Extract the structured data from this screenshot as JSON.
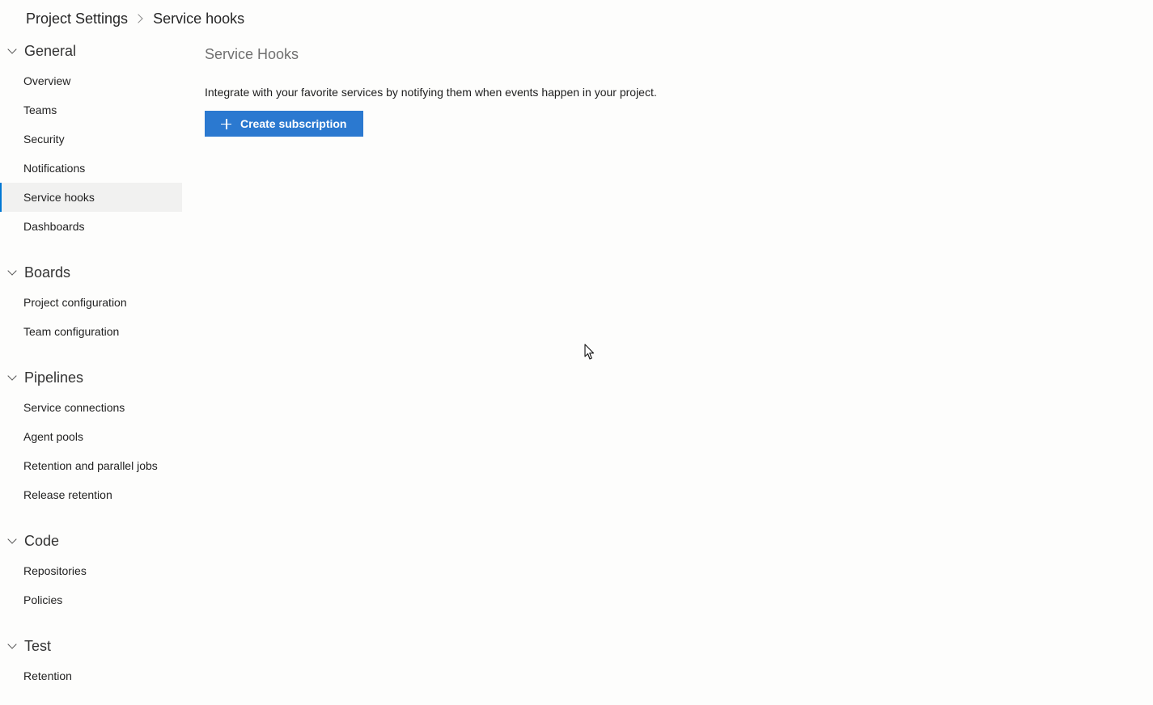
{
  "breadcrumb": {
    "root": "Project Settings",
    "current": "Service hooks"
  },
  "sidebar": {
    "groups": [
      {
        "title": "General",
        "items": [
          "Overview",
          "Teams",
          "Security",
          "Notifications",
          "Service hooks",
          "Dashboards"
        ]
      },
      {
        "title": "Boards",
        "items": [
          "Project configuration",
          "Team configuration"
        ]
      },
      {
        "title": "Pipelines",
        "items": [
          "Service connections",
          "Agent pools",
          "Retention and parallel jobs",
          "Release retention"
        ]
      },
      {
        "title": "Code",
        "items": [
          "Repositories",
          "Policies"
        ]
      },
      {
        "title": "Test",
        "items": [
          "Retention"
        ]
      }
    ],
    "selected": "Service hooks"
  },
  "main": {
    "title": "Service Hooks",
    "description": "Integrate with your favorite services by notifying them when events happen in your project.",
    "create_button_label": "Create subscription"
  },
  "colors": {
    "accent": "#0078d4",
    "primary_button": "#2b79d0",
    "selected_bg": "#f1f1f0"
  },
  "icons": {
    "breadcrumb_separator": "chevron-right-icon",
    "group_toggle": "chevron-down-icon",
    "create_button": "plus-icon",
    "cursor": "mouse-pointer-icon"
  }
}
